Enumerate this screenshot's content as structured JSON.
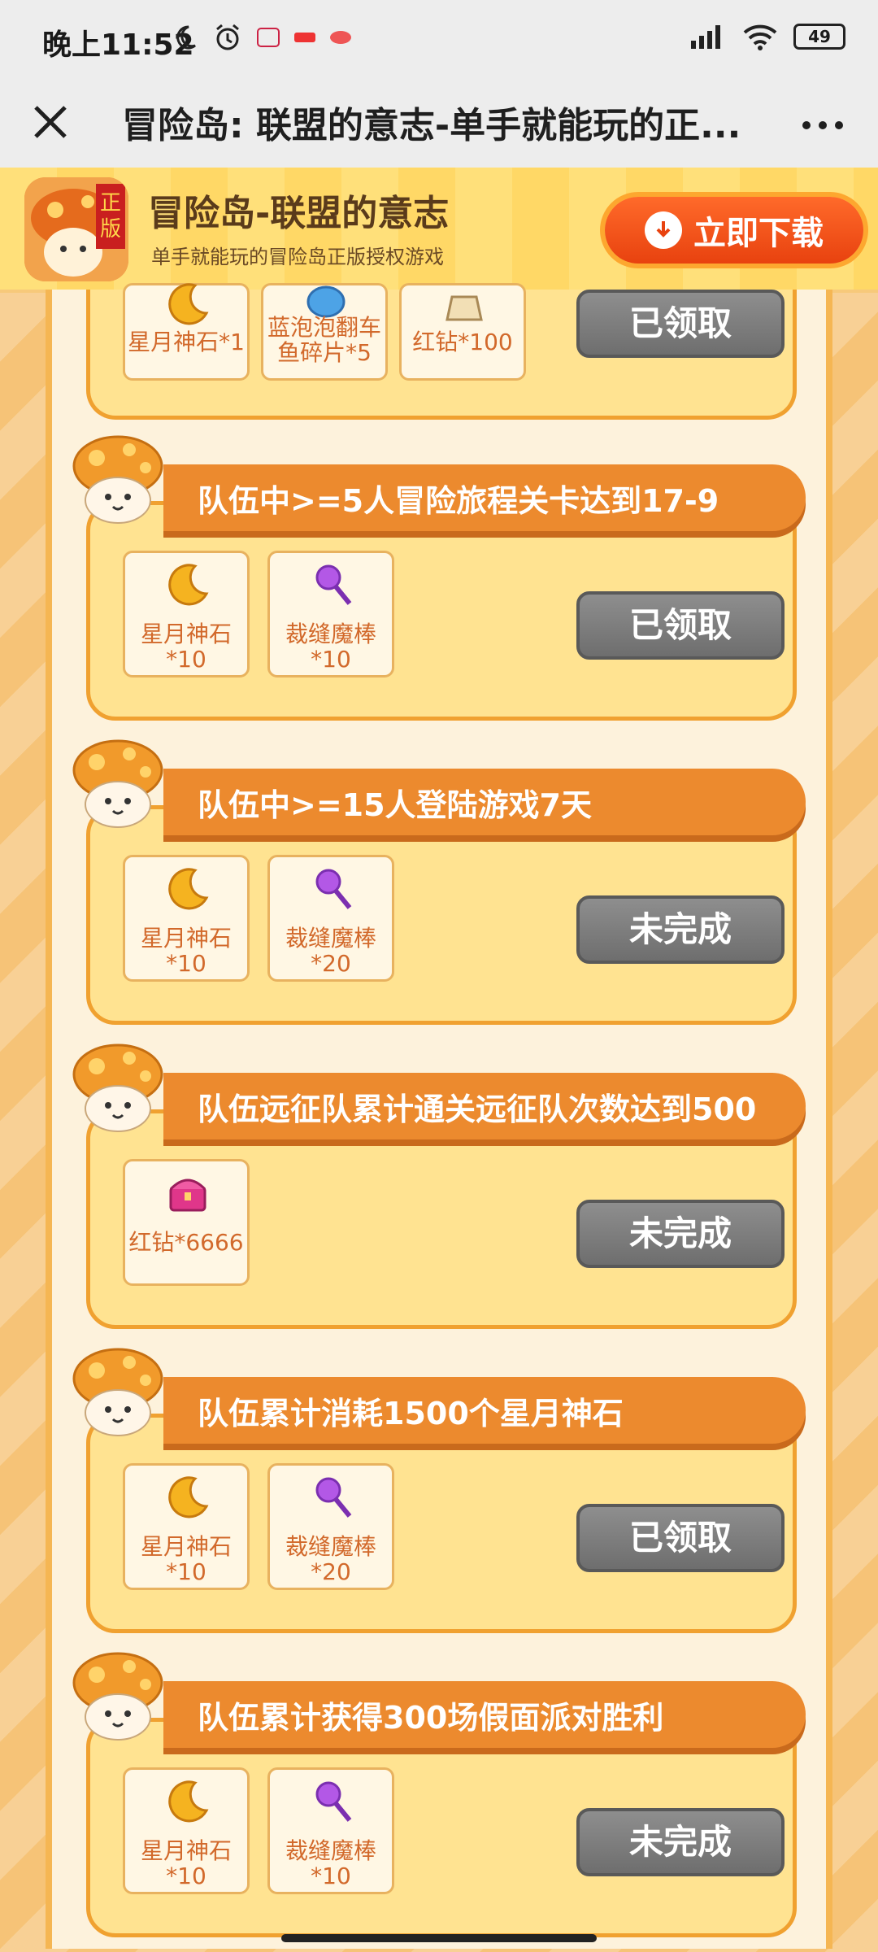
{
  "status_bar": {
    "time": "晚上11:52",
    "battery": "49"
  },
  "title_bar": {
    "title": "冒险岛: 联盟的意志-单手就能玩的正..."
  },
  "banner": {
    "app_name": "冒险岛-联盟的意志",
    "subtitle": "单手就能玩的冒险岛正版授权游戏",
    "download_label": "立即下载"
  },
  "top_card": {
    "rewards": [
      {
        "label": "星月神石*1",
        "icon": "crescent-moon-icon"
      },
      {
        "label": "蓝泡泡翻车\n鱼碎片*5",
        "icon": "blue-fish-icon"
      },
      {
        "label": "红钻*100",
        "icon": "bag-icon"
      }
    ],
    "status": "已领取"
  },
  "tasks": [
    {
      "title": "队伍中>=5人冒险旅程关卡达到17-9",
      "rewards": [
        {
          "label": "星月神石\n*10",
          "icon": "crescent-moon-icon"
        },
        {
          "label": "裁缝魔棒\n*10",
          "icon": "magic-wand-icon"
        }
      ],
      "status": "已领取"
    },
    {
      "title": "队伍中>=15人登陆游戏7天",
      "rewards": [
        {
          "label": "星月神石\n*10",
          "icon": "crescent-moon-icon"
        },
        {
          "label": "裁缝魔棒\n*20",
          "icon": "magic-wand-icon"
        }
      ],
      "status": "未完成"
    },
    {
      "title": "队伍远征队累计通关远征队次数达到500",
      "rewards": [
        {
          "label": "红钻*6666",
          "icon": "treasure-chest-icon"
        }
      ],
      "status": "未完成"
    },
    {
      "title": "队伍累计消耗1500个星月神石",
      "rewards": [
        {
          "label": "星月神石\n*10",
          "icon": "crescent-moon-icon"
        },
        {
          "label": "裁缝魔棒\n*20",
          "icon": "magic-wand-icon"
        }
      ],
      "status": "已领取"
    },
    {
      "title": "队伍累计获得300场假面派对胜利",
      "rewards": [
        {
          "label": "星月神石\n*10",
          "icon": "crescent-moon-icon"
        },
        {
          "label": "裁缝魔棒\n*10",
          "icon": "magic-wand-icon"
        }
      ],
      "status": "未完成"
    }
  ],
  "colors": {
    "header_orange": "#ec8a2e",
    "card_yellow": "#ffe391",
    "reward_text": "#d2692b",
    "button_gray": "#7c7c7c",
    "download_red": "#e8420f"
  }
}
